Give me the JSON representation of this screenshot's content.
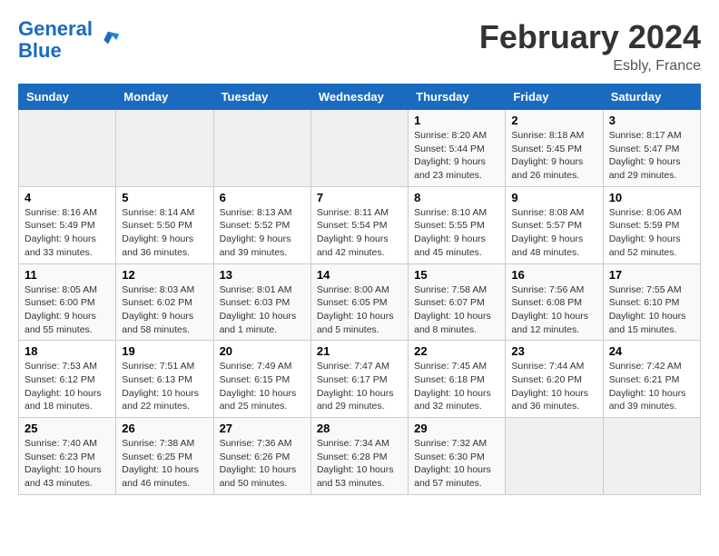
{
  "header": {
    "logo_line1": "General",
    "logo_line2": "Blue",
    "month_year": "February 2024",
    "location": "Esbly, France"
  },
  "weekdays": [
    "Sunday",
    "Monday",
    "Tuesday",
    "Wednesday",
    "Thursday",
    "Friday",
    "Saturday"
  ],
  "weeks": [
    [
      {
        "day": "",
        "info": ""
      },
      {
        "day": "",
        "info": ""
      },
      {
        "day": "",
        "info": ""
      },
      {
        "day": "",
        "info": ""
      },
      {
        "day": "1",
        "info": "Sunrise: 8:20 AM\nSunset: 5:44 PM\nDaylight: 9 hours\nand 23 minutes."
      },
      {
        "day": "2",
        "info": "Sunrise: 8:18 AM\nSunset: 5:45 PM\nDaylight: 9 hours\nand 26 minutes."
      },
      {
        "day": "3",
        "info": "Sunrise: 8:17 AM\nSunset: 5:47 PM\nDaylight: 9 hours\nand 29 minutes."
      }
    ],
    [
      {
        "day": "4",
        "info": "Sunrise: 8:16 AM\nSunset: 5:49 PM\nDaylight: 9 hours\nand 33 minutes."
      },
      {
        "day": "5",
        "info": "Sunrise: 8:14 AM\nSunset: 5:50 PM\nDaylight: 9 hours\nand 36 minutes."
      },
      {
        "day": "6",
        "info": "Sunrise: 8:13 AM\nSunset: 5:52 PM\nDaylight: 9 hours\nand 39 minutes."
      },
      {
        "day": "7",
        "info": "Sunrise: 8:11 AM\nSunset: 5:54 PM\nDaylight: 9 hours\nand 42 minutes."
      },
      {
        "day": "8",
        "info": "Sunrise: 8:10 AM\nSunset: 5:55 PM\nDaylight: 9 hours\nand 45 minutes."
      },
      {
        "day": "9",
        "info": "Sunrise: 8:08 AM\nSunset: 5:57 PM\nDaylight: 9 hours\nand 48 minutes."
      },
      {
        "day": "10",
        "info": "Sunrise: 8:06 AM\nSunset: 5:59 PM\nDaylight: 9 hours\nand 52 minutes."
      }
    ],
    [
      {
        "day": "11",
        "info": "Sunrise: 8:05 AM\nSunset: 6:00 PM\nDaylight: 9 hours\nand 55 minutes."
      },
      {
        "day": "12",
        "info": "Sunrise: 8:03 AM\nSunset: 6:02 PM\nDaylight: 9 hours\nand 58 minutes."
      },
      {
        "day": "13",
        "info": "Sunrise: 8:01 AM\nSunset: 6:03 PM\nDaylight: 10 hours\nand 1 minute."
      },
      {
        "day": "14",
        "info": "Sunrise: 8:00 AM\nSunset: 6:05 PM\nDaylight: 10 hours\nand 5 minutes."
      },
      {
        "day": "15",
        "info": "Sunrise: 7:58 AM\nSunset: 6:07 PM\nDaylight: 10 hours\nand 8 minutes."
      },
      {
        "day": "16",
        "info": "Sunrise: 7:56 AM\nSunset: 6:08 PM\nDaylight: 10 hours\nand 12 minutes."
      },
      {
        "day": "17",
        "info": "Sunrise: 7:55 AM\nSunset: 6:10 PM\nDaylight: 10 hours\nand 15 minutes."
      }
    ],
    [
      {
        "day": "18",
        "info": "Sunrise: 7:53 AM\nSunset: 6:12 PM\nDaylight: 10 hours\nand 18 minutes."
      },
      {
        "day": "19",
        "info": "Sunrise: 7:51 AM\nSunset: 6:13 PM\nDaylight: 10 hours\nand 22 minutes."
      },
      {
        "day": "20",
        "info": "Sunrise: 7:49 AM\nSunset: 6:15 PM\nDaylight: 10 hours\nand 25 minutes."
      },
      {
        "day": "21",
        "info": "Sunrise: 7:47 AM\nSunset: 6:17 PM\nDaylight: 10 hours\nand 29 minutes."
      },
      {
        "day": "22",
        "info": "Sunrise: 7:45 AM\nSunset: 6:18 PM\nDaylight: 10 hours\nand 32 minutes."
      },
      {
        "day": "23",
        "info": "Sunrise: 7:44 AM\nSunset: 6:20 PM\nDaylight: 10 hours\nand 36 minutes."
      },
      {
        "day": "24",
        "info": "Sunrise: 7:42 AM\nSunset: 6:21 PM\nDaylight: 10 hours\nand 39 minutes."
      }
    ],
    [
      {
        "day": "25",
        "info": "Sunrise: 7:40 AM\nSunset: 6:23 PM\nDaylight: 10 hours\nand 43 minutes."
      },
      {
        "day": "26",
        "info": "Sunrise: 7:38 AM\nSunset: 6:25 PM\nDaylight: 10 hours\nand 46 minutes."
      },
      {
        "day": "27",
        "info": "Sunrise: 7:36 AM\nSunset: 6:26 PM\nDaylight: 10 hours\nand 50 minutes."
      },
      {
        "day": "28",
        "info": "Sunrise: 7:34 AM\nSunset: 6:28 PM\nDaylight: 10 hours\nand 53 minutes."
      },
      {
        "day": "29",
        "info": "Sunrise: 7:32 AM\nSunset: 6:30 PM\nDaylight: 10 hours\nand 57 minutes."
      },
      {
        "day": "",
        "info": ""
      },
      {
        "day": "",
        "info": ""
      }
    ]
  ]
}
